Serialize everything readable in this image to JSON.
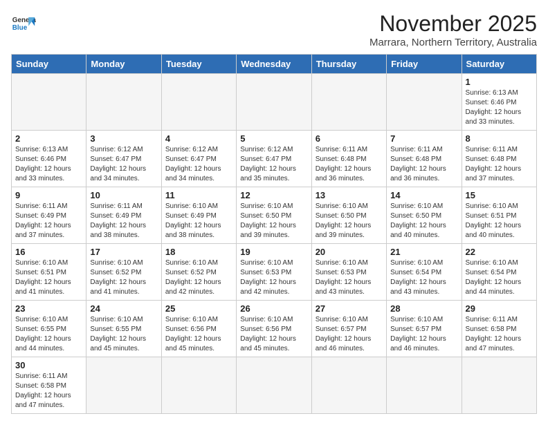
{
  "header": {
    "logo_general": "General",
    "logo_blue": "Blue",
    "month_title": "November 2025",
    "location": "Marrara, Northern Territory, Australia"
  },
  "weekdays": [
    "Sunday",
    "Monday",
    "Tuesday",
    "Wednesday",
    "Thursday",
    "Friday",
    "Saturday"
  ],
  "weeks": [
    [
      {
        "day": "",
        "info": ""
      },
      {
        "day": "",
        "info": ""
      },
      {
        "day": "",
        "info": ""
      },
      {
        "day": "",
        "info": ""
      },
      {
        "day": "",
        "info": ""
      },
      {
        "day": "",
        "info": ""
      },
      {
        "day": "1",
        "info": "Sunrise: 6:13 AM\nSunset: 6:46 PM\nDaylight: 12 hours and 33 minutes."
      }
    ],
    [
      {
        "day": "2",
        "info": "Sunrise: 6:13 AM\nSunset: 6:46 PM\nDaylight: 12 hours and 33 minutes."
      },
      {
        "day": "3",
        "info": "Sunrise: 6:12 AM\nSunset: 6:47 PM\nDaylight: 12 hours and 34 minutes."
      },
      {
        "day": "4",
        "info": "Sunrise: 6:12 AM\nSunset: 6:47 PM\nDaylight: 12 hours and 34 minutes."
      },
      {
        "day": "5",
        "info": "Sunrise: 6:12 AM\nSunset: 6:47 PM\nDaylight: 12 hours and 35 minutes."
      },
      {
        "day": "6",
        "info": "Sunrise: 6:11 AM\nSunset: 6:48 PM\nDaylight: 12 hours and 36 minutes."
      },
      {
        "day": "7",
        "info": "Sunrise: 6:11 AM\nSunset: 6:48 PM\nDaylight: 12 hours and 36 minutes."
      },
      {
        "day": "8",
        "info": "Sunrise: 6:11 AM\nSunset: 6:48 PM\nDaylight: 12 hours and 37 minutes."
      }
    ],
    [
      {
        "day": "9",
        "info": "Sunrise: 6:11 AM\nSunset: 6:49 PM\nDaylight: 12 hours and 37 minutes."
      },
      {
        "day": "10",
        "info": "Sunrise: 6:11 AM\nSunset: 6:49 PM\nDaylight: 12 hours and 38 minutes."
      },
      {
        "day": "11",
        "info": "Sunrise: 6:10 AM\nSunset: 6:49 PM\nDaylight: 12 hours and 38 minutes."
      },
      {
        "day": "12",
        "info": "Sunrise: 6:10 AM\nSunset: 6:50 PM\nDaylight: 12 hours and 39 minutes."
      },
      {
        "day": "13",
        "info": "Sunrise: 6:10 AM\nSunset: 6:50 PM\nDaylight: 12 hours and 39 minutes."
      },
      {
        "day": "14",
        "info": "Sunrise: 6:10 AM\nSunset: 6:50 PM\nDaylight: 12 hours and 40 minutes."
      },
      {
        "day": "15",
        "info": "Sunrise: 6:10 AM\nSunset: 6:51 PM\nDaylight: 12 hours and 40 minutes."
      }
    ],
    [
      {
        "day": "16",
        "info": "Sunrise: 6:10 AM\nSunset: 6:51 PM\nDaylight: 12 hours and 41 minutes."
      },
      {
        "day": "17",
        "info": "Sunrise: 6:10 AM\nSunset: 6:52 PM\nDaylight: 12 hours and 41 minutes."
      },
      {
        "day": "18",
        "info": "Sunrise: 6:10 AM\nSunset: 6:52 PM\nDaylight: 12 hours and 42 minutes."
      },
      {
        "day": "19",
        "info": "Sunrise: 6:10 AM\nSunset: 6:53 PM\nDaylight: 12 hours and 42 minutes."
      },
      {
        "day": "20",
        "info": "Sunrise: 6:10 AM\nSunset: 6:53 PM\nDaylight: 12 hours and 43 minutes."
      },
      {
        "day": "21",
        "info": "Sunrise: 6:10 AM\nSunset: 6:54 PM\nDaylight: 12 hours and 43 minutes."
      },
      {
        "day": "22",
        "info": "Sunrise: 6:10 AM\nSunset: 6:54 PM\nDaylight: 12 hours and 44 minutes."
      }
    ],
    [
      {
        "day": "23",
        "info": "Sunrise: 6:10 AM\nSunset: 6:55 PM\nDaylight: 12 hours and 44 minutes."
      },
      {
        "day": "24",
        "info": "Sunrise: 6:10 AM\nSunset: 6:55 PM\nDaylight: 12 hours and 45 minutes."
      },
      {
        "day": "25",
        "info": "Sunrise: 6:10 AM\nSunset: 6:56 PM\nDaylight: 12 hours and 45 minutes."
      },
      {
        "day": "26",
        "info": "Sunrise: 6:10 AM\nSunset: 6:56 PM\nDaylight: 12 hours and 45 minutes."
      },
      {
        "day": "27",
        "info": "Sunrise: 6:10 AM\nSunset: 6:57 PM\nDaylight: 12 hours and 46 minutes."
      },
      {
        "day": "28",
        "info": "Sunrise: 6:10 AM\nSunset: 6:57 PM\nDaylight: 12 hours and 46 minutes."
      },
      {
        "day": "29",
        "info": "Sunrise: 6:11 AM\nSunset: 6:58 PM\nDaylight: 12 hours and 47 minutes."
      }
    ],
    [
      {
        "day": "30",
        "info": "Sunrise: 6:11 AM\nSunset: 6:58 PM\nDaylight: 12 hours and 47 minutes."
      },
      {
        "day": "",
        "info": ""
      },
      {
        "day": "",
        "info": ""
      },
      {
        "day": "",
        "info": ""
      },
      {
        "day": "",
        "info": ""
      },
      {
        "day": "",
        "info": ""
      },
      {
        "day": "",
        "info": ""
      }
    ]
  ]
}
